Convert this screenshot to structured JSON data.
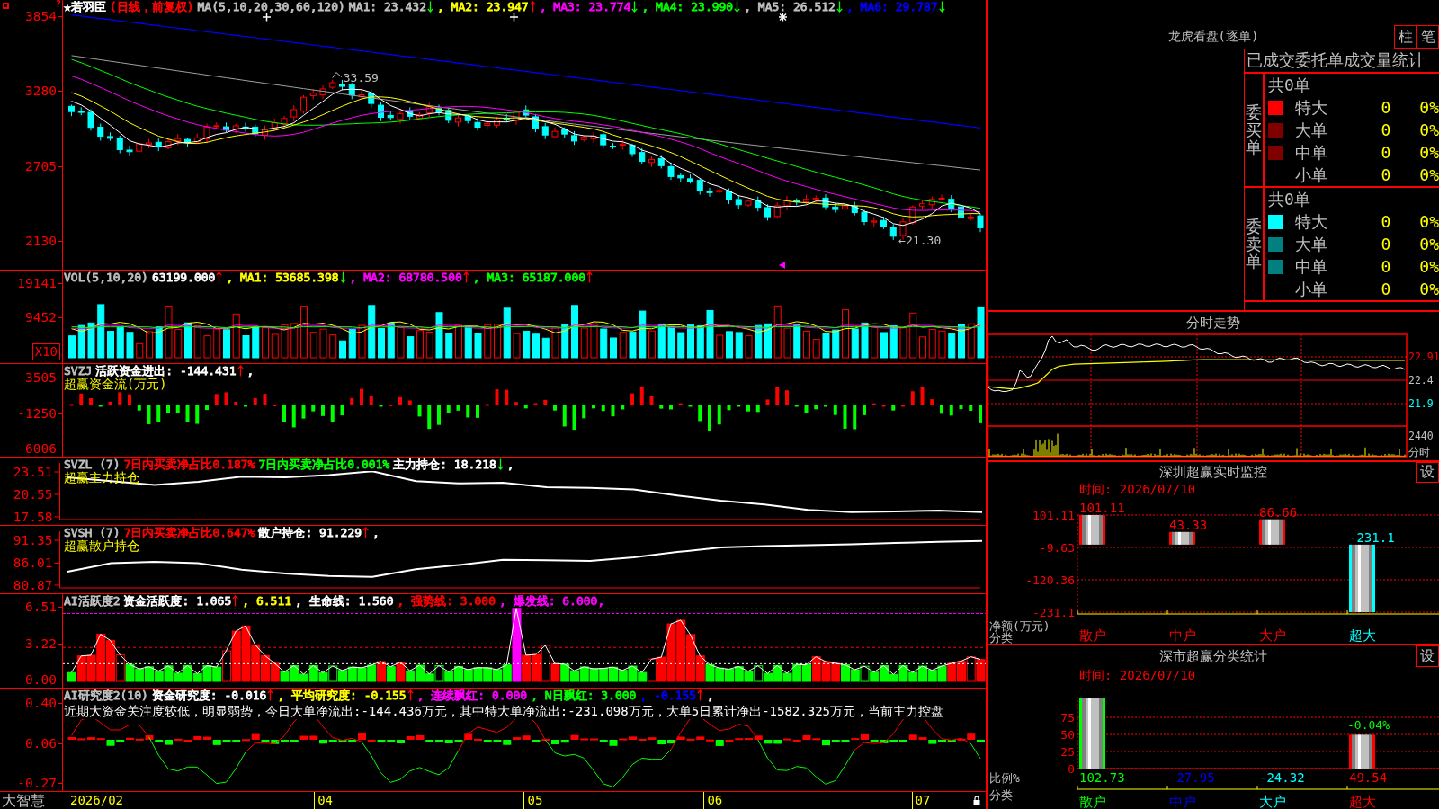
{
  "main_panel": {
    "header": [
      {
        "text": "★若羽臣",
        "color": "#ffffff"
      },
      {
        "text": "(日线，前复权)",
        "color": "#ff0000"
      },
      {
        "text": "MA(5,10,20,30,60,120)",
        "color": "#c0c0c0"
      },
      {
        "text": "MA1: 23.432",
        "color": "#c0c0c0",
        "rising": false
      },
      {
        "text": ", MA2: 23.947",
        "color": "#ffff00",
        "rising": true
      },
      {
        "text": ", MA3: 23.774",
        "color": "#ff00ff",
        "rising": false
      },
      {
        "text": ", MA4: 23.990",
        "color": "#00ff00",
        "rising": false
      },
      {
        "text": ", MA5: 26.512",
        "color": "#c0c0c0",
        "rising": false
      },
      {
        "text": ", MA6: 29.787",
        "color": "#0000ff",
        "rising": false
      }
    ],
    "help_mark": "?",
    "y_ticks": [
      "3854",
      "3280",
      "2705",
      "2130"
    ],
    "high_label": "33.59",
    "low_label": "←21.30"
  },
  "indicator_panels": [
    {
      "kind": "volume",
      "header": [
        {
          "text": "VOL(5,10,20)",
          "color": "#c0c0c0"
        },
        {
          "text": "63199.000",
          "color": "#ffffff",
          "rising": true
        },
        {
          "text": ", MA1: 53685.398",
          "color": "#ffff00",
          "rising": false
        },
        {
          "text": ", MA2: 68780.500",
          "color": "#ff00ff",
          "rising": true
        },
        {
          "text": ", MA3: 65187.000",
          "color": "#00ff00",
          "rising": true
        }
      ],
      "y_ticks": [
        "19141",
        "9452"
      ],
      "scale_badge": "X10"
    },
    {
      "kind": "flow",
      "header": [
        {
          "text": "SVZJ",
          "color": "#c0c0c0"
        },
        {
          "text": "活跃资金进出: -144.431",
          "color": "#ffffff",
          "rising": true
        },
        {
          "text": ","
        }
      ],
      "subtitle": "超赢资金流(万元)",
      "y_ticks": [
        "3505",
        "-1250",
        "-6006"
      ]
    },
    {
      "kind": "line",
      "header": [
        {
          "text": "SVZL (7)",
          "color": "#c0c0c0"
        },
        {
          "text": "7日内买卖净占比0.187%",
          "color": "#ff0000"
        },
        {
          "text": "7日内买卖净占比0.001%",
          "color": "#00ff00"
        },
        {
          "text": "主力持仓: 18.218",
          "color": "#ffffff",
          "rising": false
        },
        {
          "text": ","
        }
      ],
      "chart_data": {
        "type": "line",
        "title": "超赢主力持仓",
        "categories": [
          null,
          null,
          null,
          null,
          null,
          null,
          null,
          null,
          null,
          null,
          null,
          null,
          null,
          null,
          null,
          null,
          null,
          null,
          null,
          null,
          null,
          null
        ],
        "yticks": [
          23.51,
          20.55,
          17.58
        ],
        "ylim": [
          17.22,
          24.7
        ],
        "series": [
          {
            "values": [
              22.8,
              22.3,
              21.8,
              22.2,
              22.9,
              22.8,
              23.1,
              23.6,
              22.3,
              22.0,
              22.1,
              21.5,
              21.4,
              21.2,
              20.4,
              19.7,
              19.2,
              18.5,
              18.2,
              18.3,
              18.4,
              18.2
            ]
          }
        ]
      }
    },
    {
      "kind": "line",
      "header": [
        {
          "text": "SVSH (7)",
          "color": "#c0c0c0"
        },
        {
          "text": "7日内买卖净占比0.647%",
          "color": "#ff0000"
        },
        {
          "text": "散户持仓: 91.229",
          "color": "#ffffff",
          "rising": true
        },
        {
          "text": ","
        }
      ],
      "chart_data": {
        "type": "line",
        "title": "超赢散户持仓",
        "categories": [
          null,
          null,
          null,
          null,
          null,
          null,
          null,
          null,
          null,
          null,
          null,
          null,
          null,
          null,
          null,
          null,
          null,
          null,
          null,
          null,
          null,
          null
        ],
        "yticks": [
          91.35,
          86.01,
          80.87
        ],
        "ylim": [
          80.24,
          93.45
        ],
        "series": [
          {
            "values": [
              84.0,
              86.0,
              86.3,
              86.0,
              84.5,
              83.6,
              83.0,
              82.8,
              84.6,
              85.6,
              86.8,
              86.7,
              86.5,
              87.4,
              88.6,
              89.7,
              90.0,
              90.2,
              90.4,
              90.7,
              91.0,
              91.2
            ]
          }
        ]
      }
    },
    {
      "kind": "activity",
      "header": [
        {
          "text": "AI活跃度2",
          "color": "#c0c0c0"
        },
        {
          "text": "资金活跃度: 1.065",
          "color": "#ffffff",
          "rising": true
        },
        {
          "text": ", 6.511",
          "color": "#ffff00"
        },
        {
          "text": ", 生命线: 1.560",
          "color": "#ffffff"
        },
        {
          "text": ", 强势线: 3.000",
          "color": "#ff0000"
        },
        {
          "text": ", 爆发线: 6.000,",
          "color": "#ff00ff"
        }
      ],
      "y_ticks": [
        "6.51",
        "3.22",
        "0.00"
      ]
    },
    {
      "kind": "research",
      "header": [
        {
          "text": "AI研究度2(10)",
          "color": "#c0c0c0"
        },
        {
          "text": "资金研究度: -0.016",
          "color": "#ffffff",
          "rising": true
        },
        {
          "text": ", 平均研究度: -0.155",
          "color": "#ffff00",
          "rising": true
        },
        {
          "text": ", 连续飘红: 0.000",
          "color": "#ff00ff"
        },
        {
          "text": ", N日飘红: 3.000",
          "color": "#00ff00"
        },
        {
          "text": ", -0.155",
          "color": "#0000ff",
          "rising": true
        },
        {
          "text": ","
        }
      ],
      "comment": "近期大资金关注度较低，明显弱势，今日大单净流出:-144.436万元，其中特大单净流出:-231.098万元，大单5日累计净出-1582.325万元，当前主力控盘",
      "y_ticks": [
        "0.40",
        "0.06",
        "-0.27"
      ]
    }
  ],
  "date_axis": {
    "brand": "大智慧",
    "labels": [
      "2026/02",
      "04",
      "05",
      "06",
      "07"
    ]
  },
  "order_panel": {
    "title": "龙虎看盘(逐单)",
    "modes": [
      "柱",
      "笔"
    ],
    "table_title": "已成交委托单成交量统计",
    "groups": [
      {
        "label": "委买单",
        "total": "共0单",
        "rows": [
          {
            "name": "特大",
            "color": "#ff0000",
            "count": "0",
            "percent": "0%"
          },
          {
            "name": "大单",
            "color": "#800000",
            "count": "0",
            "percent": "0%"
          },
          {
            "name": "中单",
            "color": "#800000",
            "count": "0",
            "percent": "0%"
          },
          {
            "name": "小单",
            "count": "0",
            "percent": "0%"
          }
        ]
      },
      {
        "label": "委卖单",
        "total": "共0单",
        "rows": [
          {
            "name": "特大",
            "color": "#00ffff",
            "count": "0",
            "percent": "0%"
          },
          {
            "name": "大单",
            "color": "#008080",
            "count": "0",
            "percent": "0%"
          },
          {
            "name": "中单",
            "color": "#008080",
            "count": "0",
            "percent": "0%"
          },
          {
            "name": "小单",
            "count": "0",
            "percent": "0%"
          }
        ]
      }
    ]
  },
  "intraday_panel": {
    "title": "分时走势",
    "price_ticks": [
      "22.91",
      "22.4",
      "21.9"
    ],
    "volume_tick": "2440",
    "volume_label": "分时"
  },
  "monitor_panel": {
    "title": "深圳超赢实时监控",
    "settings": "设",
    "time": "时间: 2026/07/10",
    "chart_data": {
      "type": "bar",
      "ylabel": "净额(万元)",
      "xlabel": "分类",
      "categories": [
        "散户",
        "中户",
        "大户",
        "超大"
      ],
      "series": [
        {
          "values": [
            101.11,
            43.33,
            86.66,
            -231.1
          ]
        }
      ],
      "yticks": [
        101.11,
        -9.63,
        -120.36,
        -231.1
      ],
      "ylim": [
        -231.1,
        101.11
      ],
      "grid": true,
      "data_labels": true
    }
  },
  "category_panel": {
    "title": "深市超赢分类统计",
    "settings": "设",
    "time": "时间: 2026/07/10",
    "category_styles": [
      {
        "color": "#00ff00"
      },
      {
        "color": "#0000ff"
      },
      {
        "color": "#00ffff"
      },
      {
        "color": "#ff0000"
      }
    ],
    "chart_data": {
      "type": "bar",
      "ylabel": "比例%",
      "xlabel": "分类",
      "categories": [
        "散户",
        "中户",
        "大户",
        "超大"
      ],
      "series": [
        {
          "values": [
            102.73,
            null,
            null,
            49.54
          ]
        }
      ],
      "yticks": [
        0,
        25,
        50,
        75
      ],
      "ylim": [
        0,
        105
      ],
      "grid": true,
      "value_labels": [
        "102.73",
        "-27.95",
        "-24.32",
        "49.54"
      ],
      "annotations": [
        "-0.04%"
      ]
    }
  }
}
